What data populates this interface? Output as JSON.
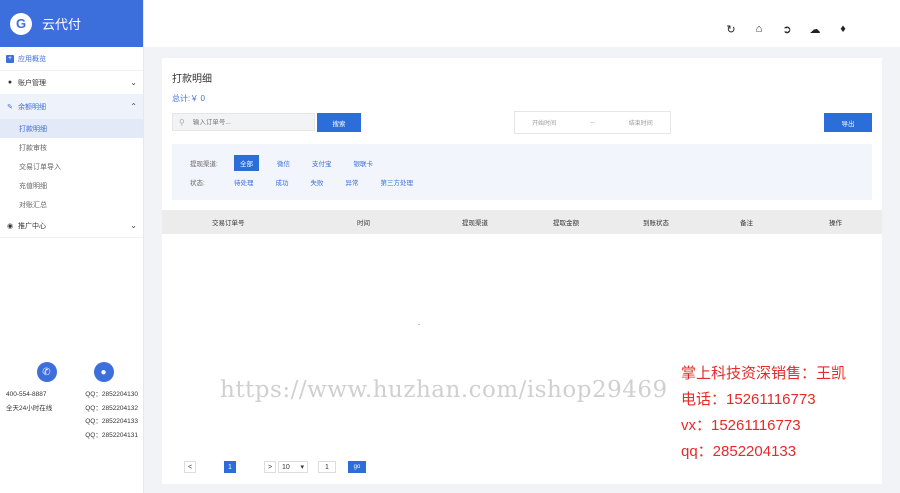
{
  "brand": {
    "name": "云代付",
    "logo_letter": "G"
  },
  "sidebar": {
    "items": [
      {
        "label": "应用概览",
        "icon": "plus-square-icon"
      },
      {
        "label": "账户管理",
        "icon": "user-icon",
        "chevron": "expand"
      },
      {
        "label": "余额明细",
        "icon": "edit-icon",
        "chevron": "collapse"
      },
      {
        "label": "推广中心",
        "icon": "globe-icon",
        "chevron": "expand"
      }
    ],
    "sub_items": [
      "打款明细",
      "打款审核",
      "交易订单导入",
      "充值明细",
      "对账汇总"
    ]
  },
  "contact": {
    "phone": "400-554-8887",
    "hours": "全天24小时在线",
    "qq_list": [
      "QQ：2852204130",
      "QQ：2852204132",
      "QQ：2852204133",
      "QQ：2852204131"
    ]
  },
  "topbar": {
    "icons": [
      "refresh-icon",
      "home-icon",
      "logout-icon",
      "cloud-download-icon",
      "bell-icon"
    ]
  },
  "main": {
    "title": "打款明细",
    "total": "总计:￥ 0",
    "search": {
      "placeholder": "输入订单号...",
      "button": "搜索"
    },
    "date_range": {
      "start": "开始时间",
      "separator": "--",
      "end": "结束时间"
    },
    "export_label": "导出",
    "filters": {
      "channel_label": "提现渠道:",
      "channel_options": [
        "全部",
        "微信",
        "支付宝",
        "银联卡"
      ],
      "status_label": "状态:",
      "status_options": [
        "待处理",
        "成功",
        "失败",
        "异常",
        "第三方处理"
      ]
    },
    "table": {
      "columns": [
        "交易订单号",
        "时间",
        "提现渠道",
        "提取金额",
        "到账状态",
        "备注",
        "操作"
      ]
    },
    "pagination": {
      "prev": "<",
      "current": "1",
      "next": ">",
      "page_size": "10",
      "page_input": "1",
      "go": "go"
    }
  },
  "overlay": {
    "url": "https://www.huzhan.com/ishop29469",
    "seller_lines": [
      "掌上科技资深销售：王凯",
      "电话：15261116773",
      "vx：15261116773",
      "qq：2852204133"
    ]
  }
}
